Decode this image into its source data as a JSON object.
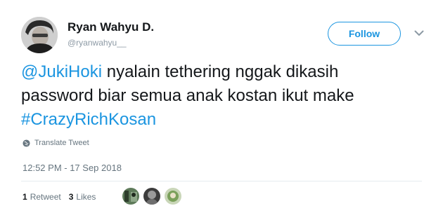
{
  "author": {
    "name": "Ryan Wahyu D.",
    "handle": "@ryanwahyu__",
    "avatar_icon": "user-avatar-icon"
  },
  "follow_button": {
    "label": "Follow",
    "color": "#1b95e0"
  },
  "more_icon": "chevron-down-icon",
  "tweet": {
    "mention": "@JukiHoki",
    "line1_text": " nyalain tethering nggak dikasih",
    "line2_text": "password biar semua anak kostan ikut make",
    "hashtag": "#CrazyRichKosan"
  },
  "translate": {
    "label": "Translate Tweet",
    "icon": "globe-icon"
  },
  "timestamp": "12:52 PM - 17 Sep 2018",
  "stats": {
    "retweets_count": "1",
    "retweets_label": "Retweet",
    "likes_count": "3",
    "likes_label": "Likes"
  },
  "likers": [
    {
      "icon": "liker-avatar-icon"
    },
    {
      "icon": "liker-avatar-icon"
    },
    {
      "icon": "liker-avatar-icon"
    }
  ],
  "colors": {
    "link": "#1b95e0",
    "text": "#14171a",
    "meta": "#66757f",
    "divider": "#e6ecf0"
  }
}
